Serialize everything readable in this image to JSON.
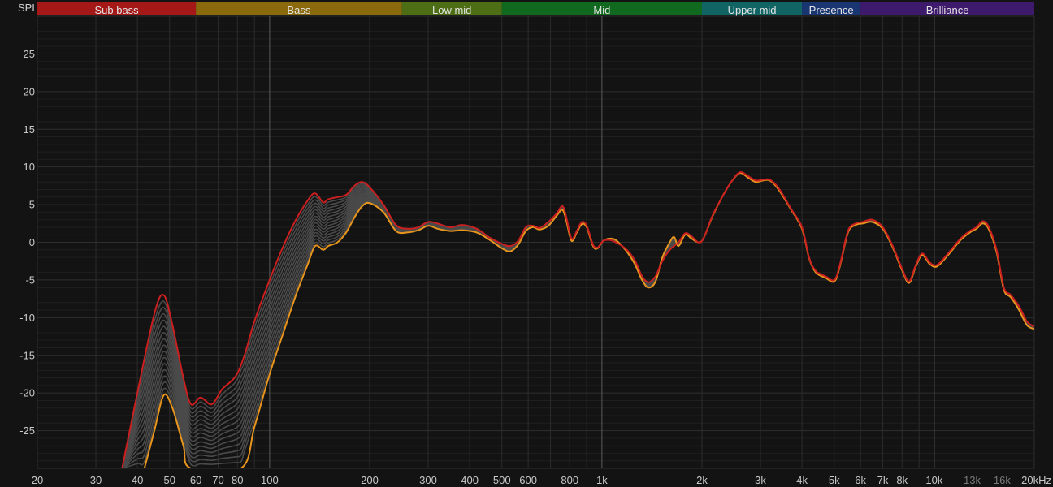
{
  "chart_data": {
    "type": "line",
    "ylabel": "SPL",
    "x_scale": "log",
    "xlim": [
      20,
      20000
    ],
    "ylim": [
      -30,
      30
    ],
    "grid": true,
    "y_ticks": [
      25,
      20,
      15,
      10,
      5,
      0,
      -5,
      -10,
      -15,
      -20,
      -25
    ],
    "x_ticks": [
      {
        "f": 20,
        "label": "20"
      },
      {
        "f": 30,
        "label": "30"
      },
      {
        "f": 40,
        "label": "40"
      },
      {
        "f": 50,
        "label": "50"
      },
      {
        "f": 60,
        "label": "60"
      },
      {
        "f": 70,
        "label": "70"
      },
      {
        "f": 80,
        "label": "80"
      },
      {
        "f": 100,
        "label": "100"
      },
      {
        "f": 200,
        "label": "200"
      },
      {
        "f": 300,
        "label": "300"
      },
      {
        "f": 400,
        "label": "400"
      },
      {
        "f": 500,
        "label": "500"
      },
      {
        "f": 600,
        "label": "600"
      },
      {
        "f": 800,
        "label": "800"
      },
      {
        "f": 1000,
        "label": "1k"
      },
      {
        "f": 2000,
        "label": "2k"
      },
      {
        "f": 3000,
        "label": "3k"
      },
      {
        "f": 4000,
        "label": "4k"
      },
      {
        "f": 5000,
        "label": "5k"
      },
      {
        "f": 6000,
        "label": "6k"
      },
      {
        "f": 7000,
        "label": "7k"
      },
      {
        "f": 8000,
        "label": "8k"
      },
      {
        "f": 10000,
        "label": "10k"
      },
      {
        "f": 13000,
        "label": "13k",
        "dim": true
      },
      {
        "f": 16000,
        "label": "16k",
        "dim": true
      },
      {
        "f": 20000,
        "label": "20kHz"
      }
    ],
    "bands": [
      {
        "label": "Sub bass",
        "from": 20,
        "to": 60,
        "color": "#a51818"
      },
      {
        "label": "Bass",
        "from": 60,
        "to": 250,
        "color": "#8a6a0c"
      },
      {
        "label": "Low mid",
        "from": 250,
        "to": 500,
        "color": "#4d6e14"
      },
      {
        "label": "Mid",
        "from": 500,
        "to": 2000,
        "color": "#11691f"
      },
      {
        "label": "Upper mid",
        "from": 2000,
        "to": 4000,
        "color": "#106464"
      },
      {
        "label": "Presence",
        "from": 4000,
        "to": 6000,
        "color": "#1a3672"
      },
      {
        "label": "Brilliance",
        "from": 6000,
        "to": 20000,
        "color": "#3d1a6b"
      }
    ],
    "series": [
      {
        "color": "#cc1f1f",
        "points": [
          [
            36,
            -30
          ],
          [
            40,
            -20
          ],
          [
            45,
            -9.5
          ],
          [
            48,
            -7
          ],
          [
            51,
            -11
          ],
          [
            55,
            -18
          ],
          [
            58,
            -21.5
          ],
          [
            62,
            -20.6
          ],
          [
            67,
            -21.5
          ],
          [
            72,
            -19.5
          ],
          [
            79,
            -17.8
          ],
          [
            84,
            -15
          ],
          [
            90,
            -10.5
          ],
          [
            100,
            -5
          ],
          [
            110,
            -0.5
          ],
          [
            120,
            3
          ],
          [
            130,
            5.5
          ],
          [
            137,
            6.5
          ],
          [
            145,
            5.3
          ],
          [
            150,
            5.7
          ],
          [
            160,
            6
          ],
          [
            170,
            6.3
          ],
          [
            180,
            7.5
          ],
          [
            190,
            8
          ],
          [
            200,
            7.3
          ],
          [
            220,
            5
          ],
          [
            240,
            2.3
          ],
          [
            260,
            1.8
          ],
          [
            280,
            2
          ],
          [
            300,
            2.7
          ],
          [
            320,
            2.5
          ],
          [
            350,
            2
          ],
          [
            380,
            2.3
          ],
          [
            420,
            1.8
          ],
          [
            460,
            0.6
          ],
          [
            500,
            -0.2
          ],
          [
            530,
            -0.5
          ],
          [
            560,
            0.2
          ],
          [
            590,
            2
          ],
          [
            620,
            2.2
          ],
          [
            650,
            1.9
          ],
          [
            690,
            2.7
          ],
          [
            730,
            3.8
          ],
          [
            760,
            4.8
          ],
          [
            780,
            3.5
          ],
          [
            810,
            0.5
          ],
          [
            840,
            1.5
          ],
          [
            870,
            2.7
          ],
          [
            900,
            2.2
          ],
          [
            940,
            -0.3
          ],
          [
            970,
            -0.7
          ],
          [
            1010,
            0.2
          ],
          [
            1060,
            0.3
          ],
          [
            1100,
            0
          ],
          [
            1150,
            -0.5
          ],
          [
            1200,
            -1.2
          ],
          [
            1260,
            -2.5
          ],
          [
            1320,
            -4.5
          ],
          [
            1380,
            -5.3
          ],
          [
            1450,
            -4.5
          ],
          [
            1520,
            -2.5
          ],
          [
            1600,
            -1
          ],
          [
            1700,
            0
          ],
          [
            1780,
            1.2
          ],
          [
            1860,
            0.8
          ],
          [
            1950,
            0
          ],
          [
            2020,
            0.5
          ],
          [
            2150,
            3.5
          ],
          [
            2300,
            6
          ],
          [
            2450,
            8
          ],
          [
            2600,
            9.3
          ],
          [
            2750,
            8.8
          ],
          [
            2900,
            8.2
          ],
          [
            3050,
            8.3
          ],
          [
            3200,
            8.3
          ],
          [
            3400,
            7.2
          ],
          [
            3700,
            4.5
          ],
          [
            4000,
            2
          ],
          [
            4200,
            -2
          ],
          [
            4400,
            -3.8
          ],
          [
            4700,
            -4.5
          ],
          [
            5000,
            -5
          ],
          [
            5200,
            -3
          ],
          [
            5500,
            1.5
          ],
          [
            5800,
            2.5
          ],
          [
            6100,
            2.7
          ],
          [
            6500,
            3
          ],
          [
            7000,
            2
          ],
          [
            7500,
            -0.5
          ],
          [
            8000,
            -3.5
          ],
          [
            8400,
            -5.2
          ],
          [
            8800,
            -3
          ],
          [
            9200,
            -1.5
          ],
          [
            9700,
            -2.7
          ],
          [
            10200,
            -3
          ],
          [
            11000,
            -1.5
          ],
          [
            12000,
            0.5
          ],
          [
            12800,
            1.5
          ],
          [
            13400,
            2
          ],
          [
            14000,
            2.8
          ],
          [
            14600,
            2
          ],
          [
            15400,
            -1
          ],
          [
            16200,
            -6
          ],
          [
            17000,
            -7
          ],
          [
            18000,
            -8.5
          ],
          [
            19000,
            -10.5
          ],
          [
            20000,
            -11.2
          ]
        ]
      },
      {
        "color": "#e8951d",
        "points": [
          [
            42,
            -30
          ],
          [
            45,
            -25
          ],
          [
            48,
            -20.3
          ],
          [
            51,
            -22
          ],
          [
            55,
            -27
          ],
          [
            58,
            -30
          ],
          [
            82,
            -30
          ],
          [
            90,
            -24.5
          ],
          [
            100,
            -17.5
          ],
          [
            110,
            -12
          ],
          [
            120,
            -7
          ],
          [
            130,
            -3
          ],
          [
            137,
            -0.5
          ],
          [
            145,
            -1
          ],
          [
            150,
            -0.5
          ],
          [
            160,
            0
          ],
          [
            170,
            1.3
          ],
          [
            180,
            3.3
          ],
          [
            190,
            4.8
          ],
          [
            200,
            5.2
          ],
          [
            220,
            4
          ],
          [
            240,
            1.5
          ],
          [
            260,
            1.3
          ],
          [
            280,
            1.6
          ],
          [
            300,
            2.2
          ],
          [
            320,
            1.8
          ],
          [
            350,
            1.5
          ],
          [
            380,
            1.6
          ],
          [
            420,
            1.3
          ],
          [
            460,
            0.3
          ],
          [
            500,
            -0.8
          ],
          [
            530,
            -1.2
          ],
          [
            560,
            -0.3
          ],
          [
            590,
            1.5
          ],
          [
            620,
            2
          ],
          [
            650,
            1.7
          ],
          [
            690,
            2.2
          ],
          [
            730,
            3.5
          ],
          [
            760,
            4.3
          ],
          [
            780,
            3
          ],
          [
            810,
            0.2
          ],
          [
            840,
            1.3
          ],
          [
            870,
            2.4
          ],
          [
            900,
            2
          ],
          [
            940,
            -0.5
          ],
          [
            970,
            -0.8
          ],
          [
            1010,
            0.2
          ],
          [
            1060,
            0.5
          ],
          [
            1100,
            0.3
          ],
          [
            1150,
            -0.5
          ],
          [
            1200,
            -1.5
          ],
          [
            1260,
            -3
          ],
          [
            1320,
            -5
          ],
          [
            1380,
            -6
          ],
          [
            1450,
            -5.2
          ],
          [
            1520,
            -2
          ],
          [
            1600,
            0
          ],
          [
            1650,
            0.7
          ],
          [
            1700,
            -0.5
          ],
          [
            1780,
            1
          ],
          [
            1860,
            0.5
          ],
          [
            1950,
            0
          ],
          [
            2020,
            0.5
          ],
          [
            2150,
            3.4
          ],
          [
            2300,
            6
          ],
          [
            2450,
            8
          ],
          [
            2600,
            9.2
          ],
          [
            2750,
            8.6
          ],
          [
            2900,
            8
          ],
          [
            3050,
            8.2
          ],
          [
            3200,
            8.2
          ],
          [
            3400,
            7
          ],
          [
            3700,
            4.4
          ],
          [
            4000,
            1.8
          ],
          [
            4200,
            -2.1
          ],
          [
            4400,
            -4
          ],
          [
            4700,
            -4.7
          ],
          [
            5000,
            -5.2
          ],
          [
            5200,
            -3.2
          ],
          [
            5500,
            1.3
          ],
          [
            5800,
            2.3
          ],
          [
            6100,
            2.5
          ],
          [
            6500,
            2.7
          ],
          [
            7000,
            1.8
          ],
          [
            7500,
            -0.7
          ],
          [
            8000,
            -3.7
          ],
          [
            8400,
            -5.4
          ],
          [
            8800,
            -3.2
          ],
          [
            9200,
            -1.7
          ],
          [
            9700,
            -2.9
          ],
          [
            10200,
            -3.2
          ],
          [
            11000,
            -1.7
          ],
          [
            12000,
            0.3
          ],
          [
            12800,
            1.3
          ],
          [
            13400,
            1.8
          ],
          [
            14000,
            2.5
          ],
          [
            14600,
            1.7
          ],
          [
            15400,
            -1.3
          ],
          [
            16200,
            -6.3
          ],
          [
            17000,
            -7.3
          ],
          [
            18000,
            -9
          ],
          [
            19000,
            -11
          ],
          [
            20000,
            -11.5
          ]
        ]
      }
    ]
  }
}
